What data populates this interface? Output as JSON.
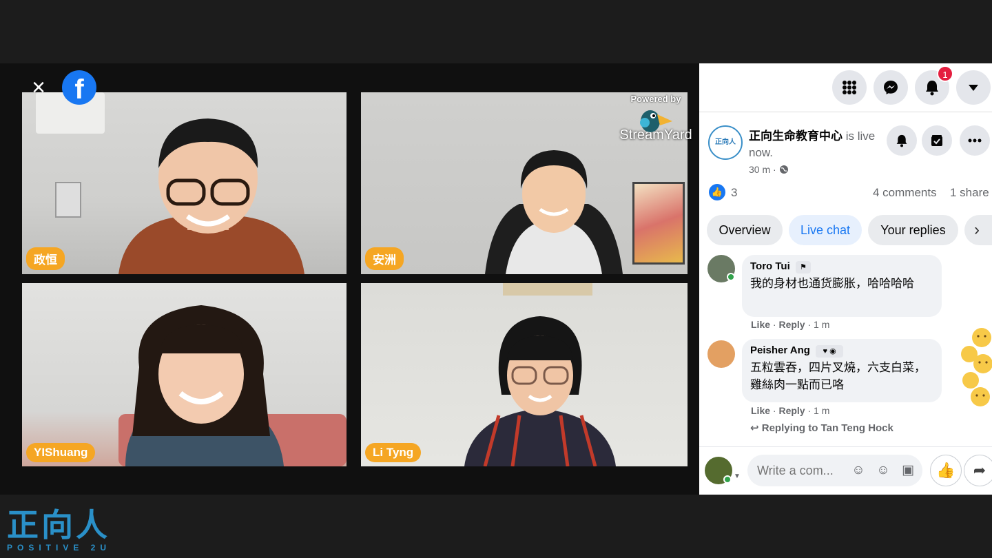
{
  "video": {
    "close_symbol": "×",
    "fb_letter": "f",
    "streamyard": {
      "powered_by": "Powered by",
      "brand": "StreamYard"
    },
    "participants": [
      {
        "name": "政恒"
      },
      {
        "name": "安洲"
      },
      {
        "name": "YIShuang"
      },
      {
        "name": "Li Tyng"
      }
    ]
  },
  "header": {
    "notification_count": "1",
    "icons": [
      "menu-grid-icon",
      "messenger-icon",
      "bell-icon",
      "caret-down-icon"
    ]
  },
  "post": {
    "page_name": "正向生命教育中心",
    "status": "is live now.",
    "time": "30 m ·",
    "likes": "3",
    "comments": "4 comments",
    "shares": "1 share",
    "avatar_text": "正向人"
  },
  "tabs": [
    {
      "label": "Overview"
    },
    {
      "label": "Live chat"
    },
    {
      "label": "Your replies"
    }
  ],
  "comments": [
    {
      "author": "Toro Tui",
      "text": "我的身材也通货膨胀，哈哈哈哈",
      "like": "Like",
      "reply": "Reply",
      "time": "1 m"
    },
    {
      "author": "Peisher Ang",
      "text": "五粒雲吞，四片叉燒，六支白菜，雞絲肉一點而已咯",
      "like": "Like",
      "reply": "Reply",
      "time": "1 m"
    }
  ],
  "replying_to": "Replying to Tan Teng Hock",
  "composer": {
    "placeholder": "Write a com..."
  },
  "brand": {
    "cn": "正向人",
    "en": "POSITIVE 2U"
  },
  "colors": {
    "facebook_blue": "#1877f2",
    "name_tag": "#f5a623",
    "notification_red": "#e41e3f",
    "brand_blue": "#2a90c8"
  }
}
